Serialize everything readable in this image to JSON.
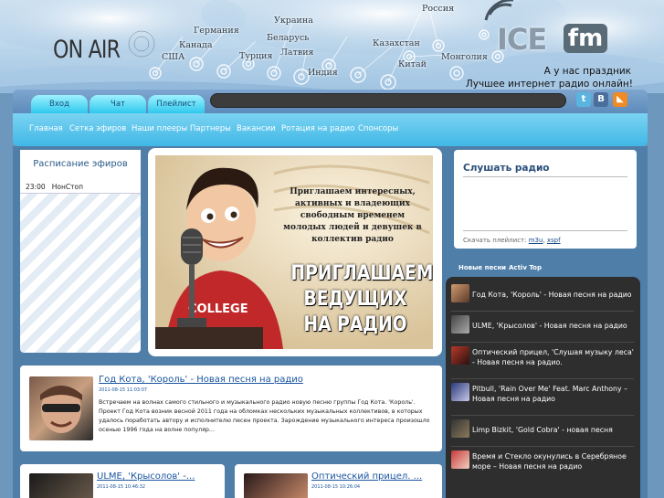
{
  "header": {
    "onair": "ON AIR",
    "countries": [
      "Россия",
      "Украина",
      "Германия",
      "Беларусь",
      "Канада",
      "США",
      "Турция",
      "Латвия",
      "Казахстан",
      "Монголия",
      "Китай",
      "Индия"
    ],
    "logo_ice": "ICE",
    "logo_fm": "fm",
    "tagline1": "А у нас праздник",
    "tagline2": "Лучшее интернет радио онлайн!"
  },
  "tabs": [
    "Вход",
    "Чат",
    "Плейлист"
  ],
  "social": [
    "twitter-icon",
    "vk-icon",
    "rss-icon"
  ],
  "nav": [
    "Главная",
    "Сетка эфиров",
    "Наши плееры",
    "Партнеры",
    "Вакансии",
    "Ротация на радио",
    "Спонсоры"
  ],
  "schedule": {
    "title": "Расписание эфиров",
    "row_time": "23:00",
    "row_name": "НонСтоп"
  },
  "banner": {
    "text_top": "Приглашаем интересных, активных и владеющих свободным временем молодых людей и девушек в коллектив радио",
    "text_big1": "ПРИГЛАШАЕМ",
    "text_big2": "ВЕДУЩИХ",
    "text_big3": "НА РАДИО",
    "shirt": "COLLEGE"
  },
  "listen": {
    "title": "Слушать радио",
    "playlist_prefix": "Скачать плейлист:",
    "m3u": "m3u",
    "xspf": "xspf"
  },
  "songs_tabs": [
    "Новые песни",
    "Activ Top"
  ],
  "songs": [
    "Год Кота, 'Король' - Новая песня на радио",
    "ULME, 'Крысолов' - Новая песня на радио",
    "Оптический прицел, 'Слушая музыку леса' - Новая песня на радио.",
    "Pitbull, 'Rain Over Me' Feat. Marc Anthony – Новая песня на радио",
    "Limp Bizkit, 'Gold Cobra' - новая песня",
    "Время и Стекло окунулись в Серебряное море – Новая песня на радио"
  ],
  "news": [
    {
      "title": "Год Кота, 'Король' - Новая песня на радио",
      "date": "2011-08-15 11:03:07",
      "text": "Встречаем на волнах самого стильного и музыкального радио новую песню группы Год Кота. 'Король'. Проект Год Кота возник весной 2011 года на обломках нескольких музыкальных коллективов, в которых удалось поработать автору и исполнителю песен проекта. Зарождение музыкального интереса произошло осенью 1996 года на волне популяр..."
    },
    {
      "title": "ULME, 'Крысолов' -...",
      "date": "2011-08-15 10:46:32"
    },
    {
      "title": "Оптический прицел. ...",
      "date": "2011-08-15 10:26:04"
    }
  ],
  "colors": {
    "accent": "#40b8e6",
    "link": "#1a55a0",
    "dark_panel": "#2e2e2e"
  }
}
